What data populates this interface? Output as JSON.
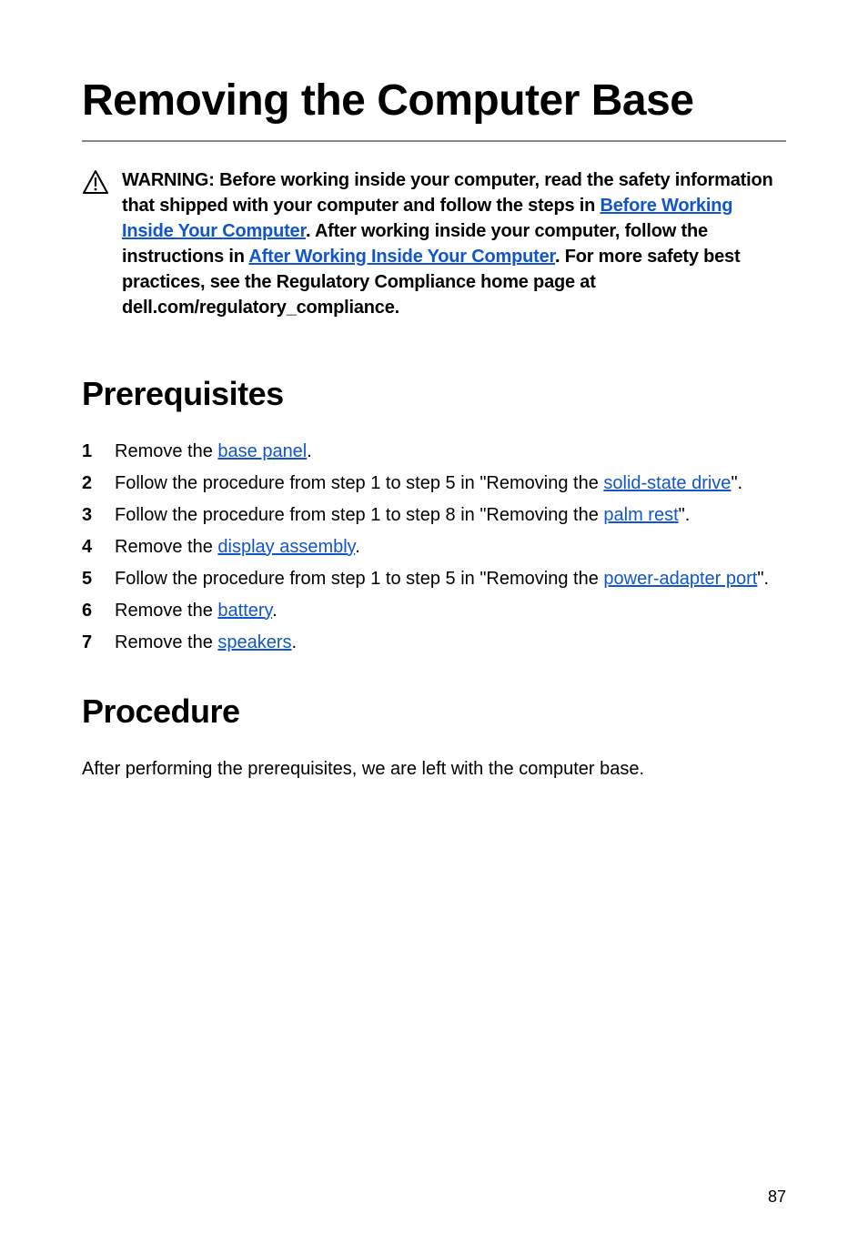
{
  "title": "Removing the Computer Base",
  "warning": {
    "part1": "WARNING: Before working inside your computer, read the safety information that shipped with your computer and follow the steps in ",
    "link1": "Before Working Inside Your Computer",
    "part2": ". After working inside your computer, follow the instructions in ",
    "link2": "After Working Inside Your Computer",
    "part3": ". For more safety best practices, see the Regulatory Compliance home page at dell.com/regulatory_compliance."
  },
  "sections": {
    "prerequisites": {
      "heading": "Prerequisites",
      "items": [
        {
          "pre": "Remove the ",
          "link": "base panel",
          "post": "."
        },
        {
          "pre": "Follow the procedure from step 1 to step 5 in \"Removing the ",
          "link": "solid-state drive",
          "post": "\"."
        },
        {
          "pre": "Follow the procedure from step 1 to step 8 in \"Removing the ",
          "link": "palm rest",
          "post": "\"."
        },
        {
          "pre": "Remove the ",
          "link": "display assembly",
          "post": "."
        },
        {
          "pre": "Follow the procedure from step 1 to step 5 in \"Removing the ",
          "link": "power-adapter port",
          "post": "\"."
        },
        {
          "pre": "Remove the ",
          "link": "battery",
          "post": "."
        },
        {
          "pre": "Remove the ",
          "link": "speakers",
          "post": "."
        }
      ]
    },
    "procedure": {
      "heading": "Procedure",
      "body": "After performing the prerequisites, we are left with the computer base."
    }
  },
  "page_number": "87"
}
